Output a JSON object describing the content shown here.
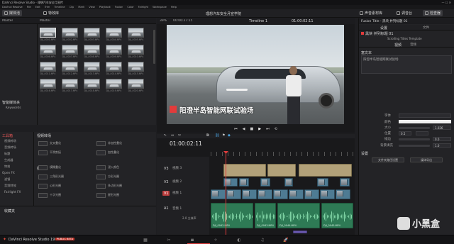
{
  "window": {
    "title": "DaVinci Resolve Studio - 理想汽车安全月宣传"
  },
  "menubar": {
    "items": [
      "DaVinci Resolve",
      "File",
      "Edit",
      "Trim",
      "Timeline",
      "Clip",
      "Mark",
      "View",
      "Playback",
      "Fusion",
      "Color",
      "Fairlight",
      "Workspace",
      "Help"
    ]
  },
  "toolbar": {
    "media_pool": "媒体池",
    "effects": "特效库",
    "project_title": "理想汽车安全月宣学院",
    "sound_library": "声音素材库",
    "mixer": "调音台",
    "inspector": "检查器"
  },
  "viewer": {
    "zoom": "39%",
    "timecode_left": "00:06:27:15",
    "timeline_name": "Timeline 1",
    "timecode_right": "01:00:02:11",
    "subtitle": "阳澄半岛智能网联试验场"
  },
  "media_pool": {
    "left_header": "Master",
    "right_header": "Master",
    "smart_bins": "智能媒体夹",
    "smart_bins_item": "Keywords",
    "thumbs": [
      "DJI_0001.MP4",
      "DJI_0002.MP4",
      "DJI_0003.MP4",
      "DJI_0004.MP4",
      "DJI_0005.MP4",
      "DJI_0006.MP4",
      "DJI_0007.MP4",
      "DJI_0008.MP4",
      "DJI_0009.MP4",
      "DJI_0010.MP4",
      "DJI_0011.MP4",
      "DJI_0012.MP4",
      "DJI_0013.MP4",
      "DJI_0014.MP4",
      "DJI_0015.MP4",
      "DJI_0016.MP4",
      "DJI_0017.MP4",
      "DJI_0018.MP4",
      "DJI_0019.MP4",
      "DJI_0020.MP4"
    ]
  },
  "effects_panel": {
    "toolbox": "工具箱",
    "items": [
      "视频转场",
      "音频转场",
      "标题",
      "生成器",
      "特效",
      "Open FX",
      "滤镜",
      "音频特效",
      "Fairlight FX"
    ],
    "section_header": "视频转场",
    "section2": "叠化",
    "section3": "光圈",
    "fx_items": [
      "交叉叠化",
      "非加性叠化",
      "平滑剪接",
      "加性叠化",
      "模糊叠化",
      "浸入颜色",
      "三角形光圈",
      "方形光圈",
      "心形光圈",
      "多边形光圈",
      "十字光圈",
      "星形光圈"
    ],
    "fav": "收藏夹"
  },
  "timeline": {
    "timecode": "01:00:02:11",
    "tracks": [
      {
        "id": "V3",
        "name": "视频 3"
      },
      {
        "id": "V2",
        "name": "视频 2"
      },
      {
        "id": "V1",
        "name": "视频 1"
      },
      {
        "id": "A1",
        "name": "音频 1",
        "sub": "2.0  立体声"
      }
    ],
    "audio_clip_labels": [
      "DJI_0042.MP4",
      "DJI_0043.MP4",
      "DJI_0044.MP4",
      "DJI_0045.MP4"
    ]
  },
  "inspector": {
    "title": "Fusion Title - 黑块 并列标题 01",
    "tab_settings": "设置",
    "tab_file": "文件",
    "subheader": "黑块 并列标题 01",
    "template": "Scrolling Titles Template",
    "tab_video": "视频",
    "tab_audio": "音频",
    "section_rich": "富文本",
    "text_value": "阳澄半岛智能网联试验场",
    "props": [
      {
        "label": "字体",
        "value": ""
      },
      {
        "label": "颜色",
        "value": ""
      },
      {
        "label": "大小",
        "value": "1.026"
      },
      {
        "label": "位置",
        "value": "0.5"
      },
      {
        "label": "描边",
        "value": "0.0"
      },
      {
        "label": "背景填充",
        "value": "1.0"
      }
    ],
    "settings_header": "设置",
    "btn_left": "文件夹路径设置",
    "btn_right": "媒体导出"
  },
  "bottom": {
    "app_name": "DaVinci Resolve Studio 19",
    "badge": "PUBLIC BETA",
    "watermark": "小黑盒"
  },
  "colors": {
    "accent_red": "#e23b3b",
    "playhead": "#e13c3c",
    "video_clip": "#4e7b93",
    "title_clip": "#b2a179",
    "audio_clip": "#2e7a55"
  }
}
